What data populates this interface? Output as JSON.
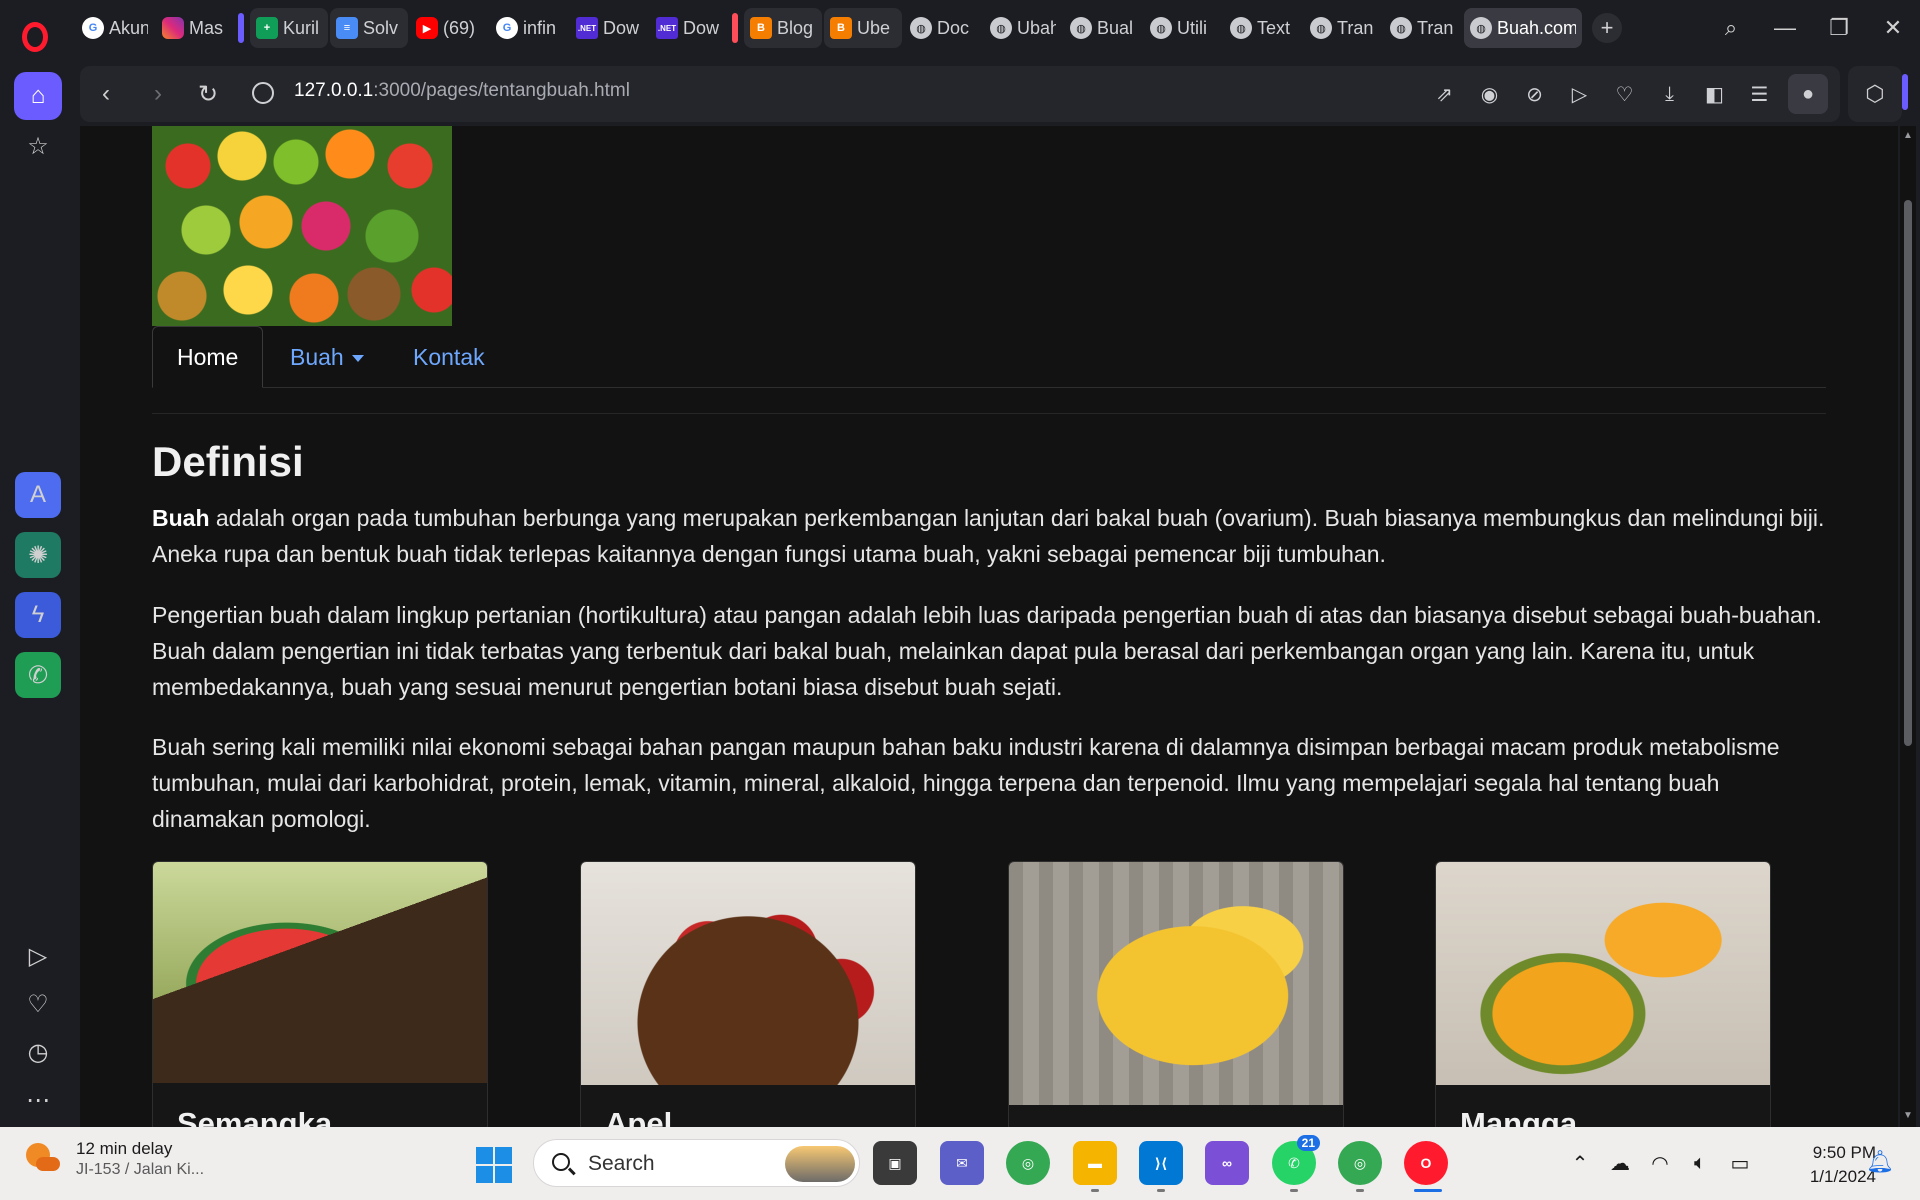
{
  "browser": {
    "tabs": [
      {
        "icon": "google-icon",
        "label": "Akun",
        "group": false
      },
      {
        "icon": "instagram-icon",
        "label": "Mas",
        "group": false
      },
      {
        "icon": "plus-icon",
        "label": "Kuril",
        "group": true
      },
      {
        "icon": "docs-icon",
        "label": "Solv",
        "group": true
      },
      {
        "icon": "youtube-icon",
        "label": "(69)",
        "group": false
      },
      {
        "icon": "google-icon",
        "label": "infin",
        "group": false
      },
      {
        "icon": "dotnet-icon",
        "label": "Dow",
        "group": false
      },
      {
        "icon": "dotnet-icon",
        "label": "Dow",
        "group": false
      },
      {
        "icon": "blogger-icon",
        "label": "Blog",
        "group": true
      },
      {
        "icon": "blogger-icon",
        "label": "Ube",
        "group": true
      },
      {
        "icon": "globe-icon",
        "label": "Doc",
        "group": false
      },
      {
        "icon": "globe-icon",
        "label": "Ubah",
        "group": false
      },
      {
        "icon": "globe-icon",
        "label": "Bual",
        "group": false
      },
      {
        "icon": "globe-icon",
        "label": "Utili",
        "group": false
      },
      {
        "icon": "globe-icon",
        "label": "Text",
        "group": false
      },
      {
        "icon": "globe-icon",
        "label": "Tran",
        "group": false
      },
      {
        "icon": "globe-icon",
        "label": "Tran",
        "group": false
      },
      {
        "icon": "globe-icon",
        "label": "Buah.com",
        "group": false,
        "active": true
      }
    ],
    "url_host": "127.0.0.1",
    "url_path": ":3000/pages/tentangbuah.html",
    "accent_color": "#6a5cff"
  },
  "nav": {
    "home": "Home",
    "buah": "Buah",
    "kontak": "Kontak"
  },
  "content": {
    "heading": "Definisi",
    "p1_bold": "Buah",
    "p1_rest": " adalah organ pada tumbuhan berbunga yang merupakan perkembangan lanjutan dari bakal buah (ovarium). Buah biasanya membungkus dan melindungi biji. Aneka rupa dan bentuk buah tidak terlepas kaitannya dengan fungsi utama buah, yakni sebagai pemencar biji tumbuhan.",
    "p2": "Pengertian buah dalam lingkup pertanian (hortikultura) atau pangan adalah lebih luas daripada pengertian buah di atas dan biasanya disebut sebagai buah-buahan. Buah dalam pengertian ini tidak terbatas yang terbentuk dari bakal buah, melainkan dapat pula berasal dari perkembangan organ yang lain. Karena itu, untuk membedakannya, buah yang sesuai menurut pengertian botani biasa disebut buah sejati.",
    "p3": "Buah sering kali memiliki nilai ekonomi sebagai bahan pangan maupun bahan baku industri karena di dalamnya disimpan berbagai macam produk metabolisme tumbuhan, mulai dari karbohidrat, protein, lemak, vitamin, mineral, alkaloid, hingga terpena dan terpenoid. Ilmu yang mempelajari segala hal tentang buah dinamakan pomologi.",
    "cards": [
      {
        "title": "Semangka"
      },
      {
        "title": "Apel"
      },
      {
        "title": ""
      },
      {
        "title": "Mangga"
      }
    ]
  },
  "taskbar": {
    "weather_line1": "12 min delay",
    "weather_line2": "JI-153 / Jalan Ki...",
    "search_placeholder": "Search",
    "whatsapp_badge": "21",
    "time": "9:50 PM",
    "date": "1/1/2024"
  }
}
